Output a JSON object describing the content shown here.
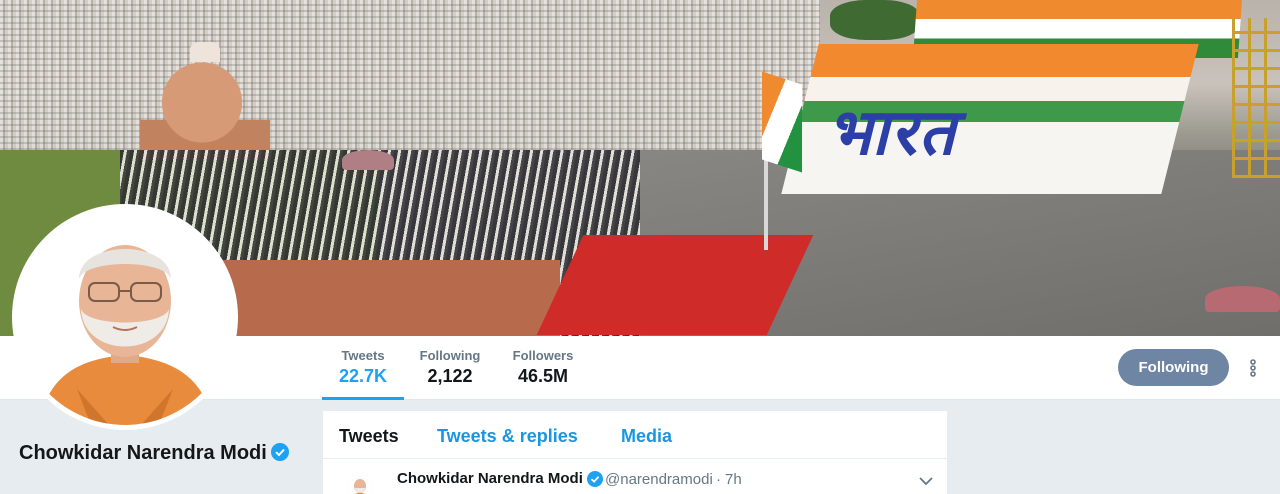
{
  "profile": {
    "name": "Chowkidar Narendra Modi",
    "verified": true
  },
  "stats": [
    {
      "label": "Tweets",
      "value": "22.7K"
    },
    {
      "label": "Following",
      "value": "2,122"
    },
    {
      "label": "Followers",
      "value": "46.5M"
    }
  ],
  "actions": {
    "follow_label": "Following",
    "more_icon": "vertical-dots-icon"
  },
  "tabs": [
    {
      "label": "Tweets"
    },
    {
      "label": "Tweets & replies"
    },
    {
      "label": "Media"
    }
  ],
  "tweet": {
    "author": "Chowkidar Narendra Modi",
    "handle": "@narendramodi",
    "separator": "·",
    "time": "7h"
  },
  "banner": {
    "sign_text": "भारत"
  },
  "colors": {
    "accent": "#1da1f2",
    "link": "#1b95e0",
    "follow_button": "#6e85a3",
    "verified": "#1da1f2"
  }
}
